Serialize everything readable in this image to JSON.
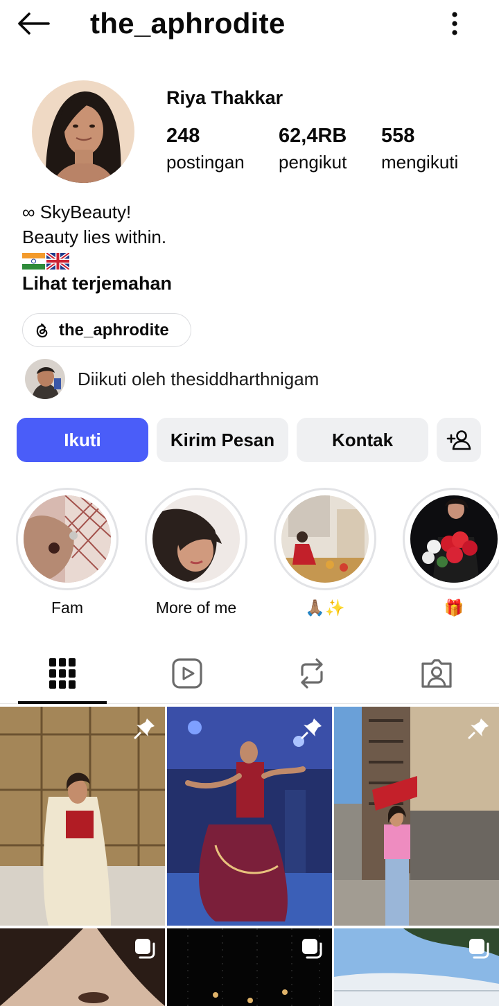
{
  "header": {
    "username": "the_aphrodite",
    "back_icon": "arrow-left-icon",
    "menu_icon": "more-vertical-icon"
  },
  "profile": {
    "full_name": "Riya Thakkar",
    "stats": [
      {
        "value": "248",
        "label": "postingan"
      },
      {
        "value": "62,4RB",
        "label": "pengikut"
      },
      {
        "value": "558",
        "label": "mengikuti"
      }
    ],
    "bio_lines": [
      "∞ SkyBeauty!",
      "Beauty lies within."
    ],
    "bio_flags": [
      "india-flag-icon",
      "uk-flag-icon"
    ],
    "translate_label": "Lihat terjemahan",
    "threads": {
      "icon": "threads-icon",
      "label": "the_aphrodite"
    },
    "followed_by": "Diikuti oleh thesiddharthnigam"
  },
  "actions": {
    "follow": "Ikuti",
    "message": "Kirim Pesan",
    "contact": "Kontak",
    "suggest_icon": "add-person-icon"
  },
  "highlights": [
    {
      "label": "Fam"
    },
    {
      "label": "More of me"
    },
    {
      "label": "🙏🏽✨"
    },
    {
      "label": "🎁"
    }
  ],
  "tabs": [
    {
      "icon": "grid-icon",
      "active": true
    },
    {
      "icon": "reels-icon",
      "active": false
    },
    {
      "icon": "repost-icon",
      "active": false
    },
    {
      "icon": "tagged-icon",
      "active": false
    }
  ],
  "colors": {
    "primary_button": "#4a5df9",
    "secondary_button": "#eff0f2",
    "text": "#0a0a0a"
  }
}
